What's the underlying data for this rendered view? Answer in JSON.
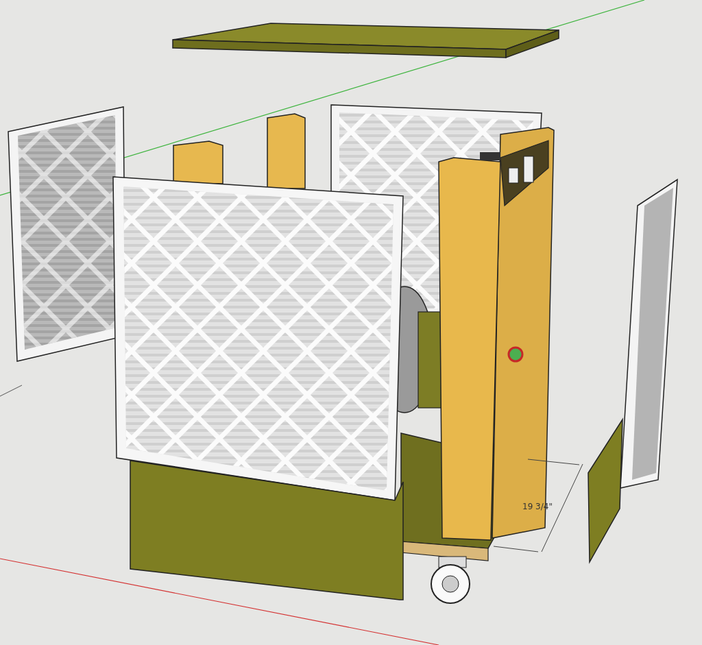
{
  "canvas": {
    "dimension_label": "19 3/4\""
  }
}
